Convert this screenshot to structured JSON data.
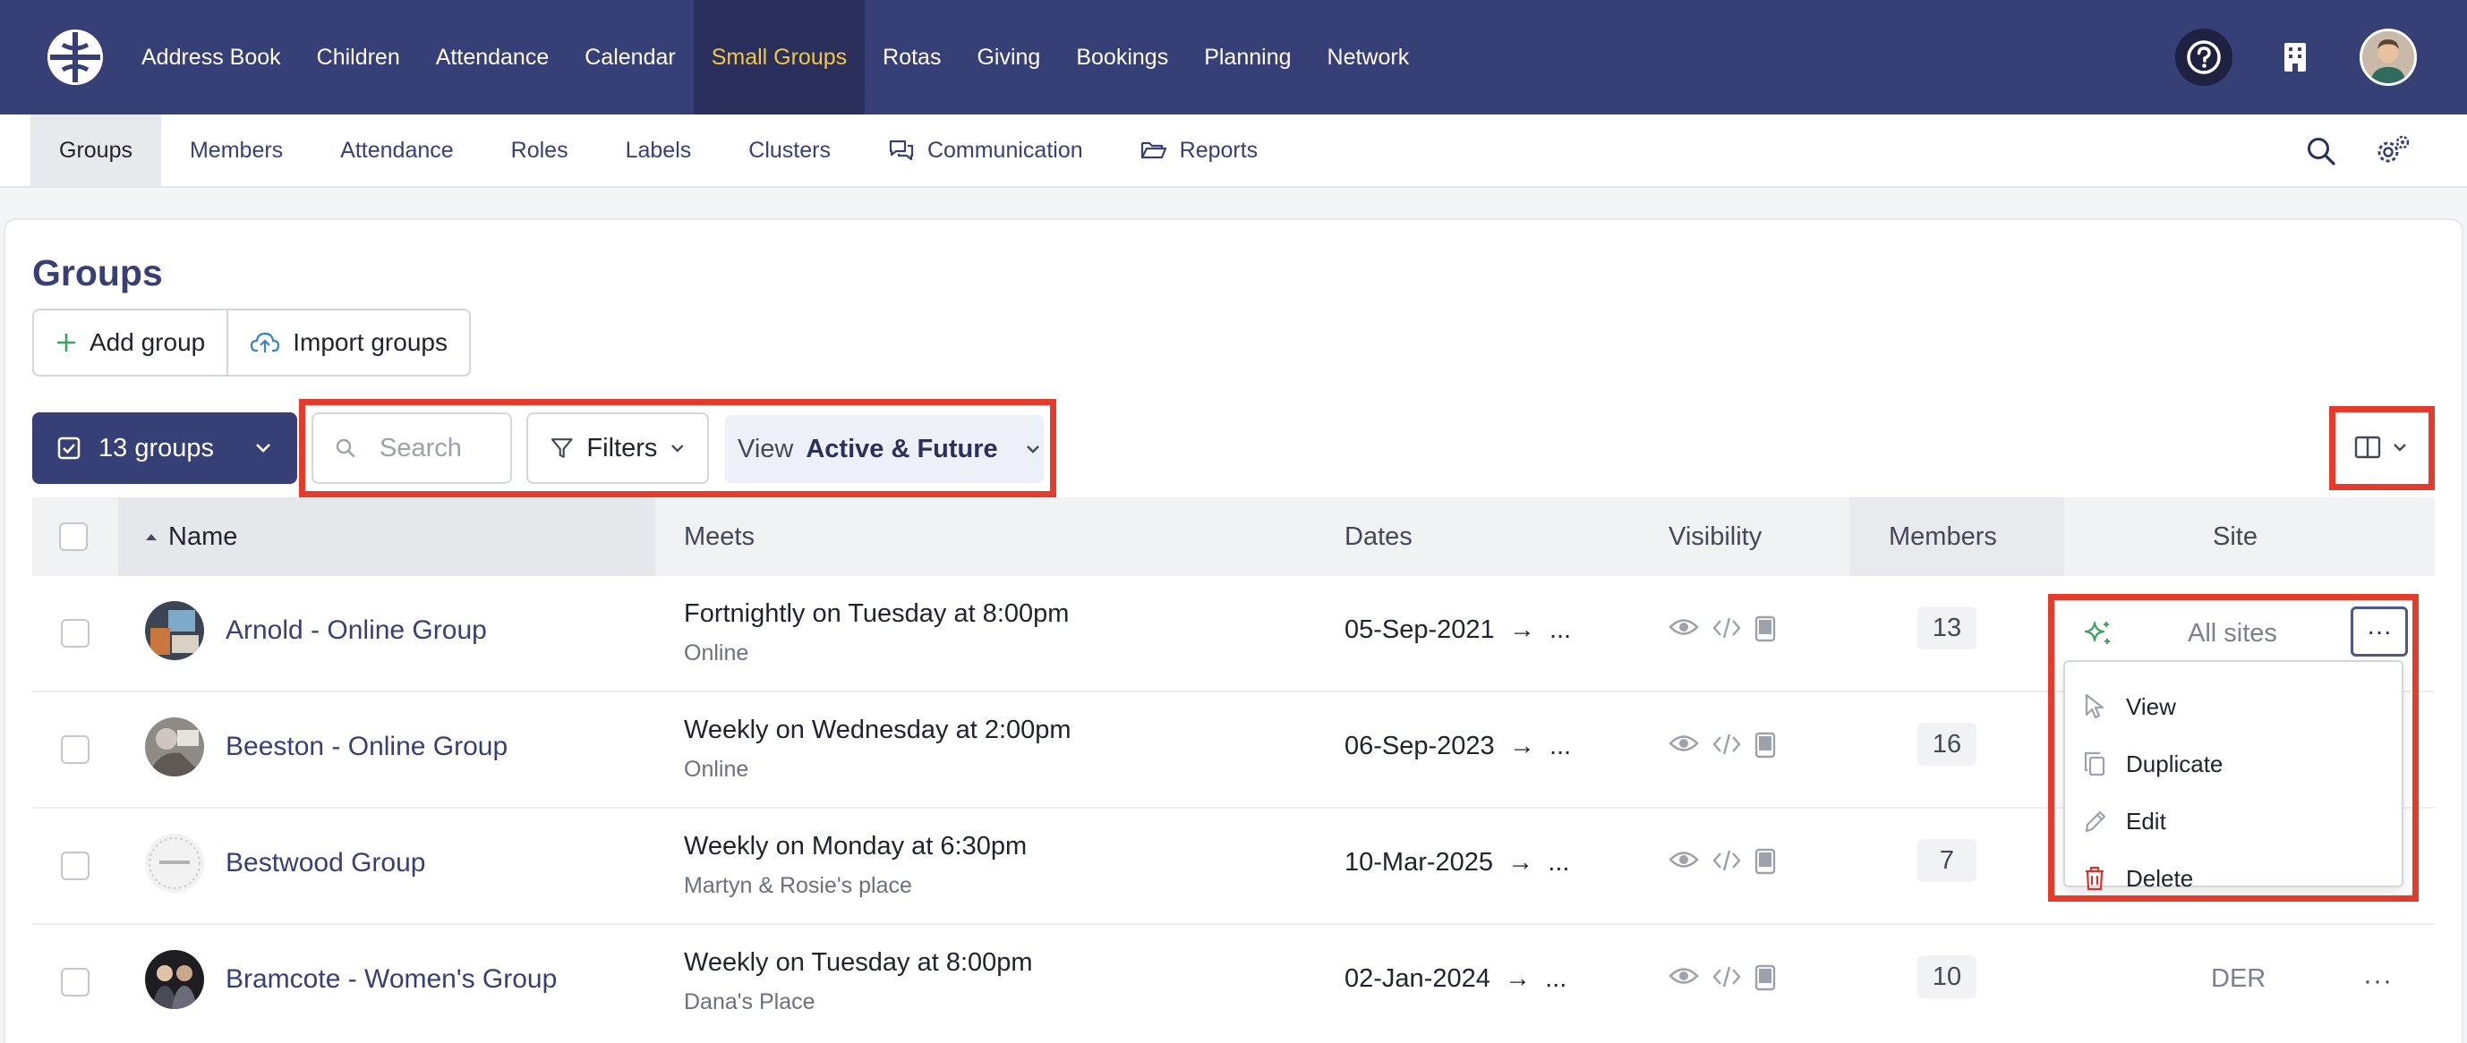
{
  "topnav": {
    "items": [
      "Address Book",
      "Children",
      "Attendance",
      "Calendar",
      "Small Groups",
      "Rotas",
      "Giving",
      "Bookings",
      "Planning",
      "Network"
    ],
    "active": "Small Groups"
  },
  "subnav": {
    "items": [
      "Groups",
      "Members",
      "Attendance",
      "Roles",
      "Labels",
      "Clusters",
      "Communication",
      "Reports"
    ]
  },
  "page": {
    "title": "Groups",
    "add_group": "Add group",
    "import_groups": "Import groups",
    "count_label": "13 groups",
    "search_placeholder": "Search",
    "filters": "Filters",
    "view_label": "View",
    "view_value": "Active & Future"
  },
  "table": {
    "headers": {
      "name": "Name",
      "meets": "Meets",
      "dates": "Dates",
      "visibility": "Visibility",
      "members": "Members",
      "site": "Site"
    },
    "rows": [
      {
        "name": "Arnold - Online Group",
        "meets": "Fortnightly on Tuesday at 8:00pm",
        "place": "Online",
        "date": "05-Sep-2021",
        "members": "13",
        "site": "All sites"
      },
      {
        "name": "Beeston - Online Group",
        "meets": "Weekly on Wednesday at 2:00pm",
        "place": "Online",
        "date": "06-Sep-2023",
        "members": "16",
        "site": ""
      },
      {
        "name": "Bestwood Group",
        "meets": "Weekly on Monday at 6:30pm",
        "place": "Martyn & Rosie's place",
        "date": "10-Mar-2025",
        "members": "7",
        "site": ""
      },
      {
        "name": "Bramcote - Women's Group",
        "meets": "Weekly on Tuesday at 8:00pm",
        "place": "Dana's Place",
        "date": "02-Jan-2024",
        "members": "10",
        "site": "DER"
      }
    ],
    "date_arrow": "→",
    "date_end": "...",
    "more": "···"
  },
  "dropdown": {
    "items": [
      "View",
      "Duplicate",
      "Edit",
      "Delete"
    ]
  },
  "colors": {
    "nav_bg": "#373f77",
    "active_nav": "#f2c744",
    "highlight": "#e53b2a",
    "delete": "#d9342b",
    "sparkle": "#3aa35a"
  }
}
